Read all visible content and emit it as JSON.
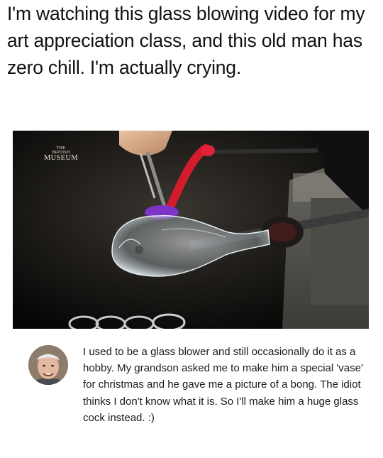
{
  "post": {
    "caption": "I'm watching this glass blowing video for my art appreciation class, and this old man has zero chill. I'm actually crying."
  },
  "video": {
    "watermark_line1": "THE",
    "watermark_line2": "BRITISH",
    "watermark_line3": "MUSEUM"
  },
  "comment": {
    "avatar_icon": "elderly-man-avatar",
    "text": "I used to be a glass blower and still occasionally do it as a hobby. My grandson asked me to make him a special 'vase' for christmas and he gave me a picture of a bong. The idiot thinks I don't know what it is. So I'll make him a huge glass cock instead. :)"
  }
}
